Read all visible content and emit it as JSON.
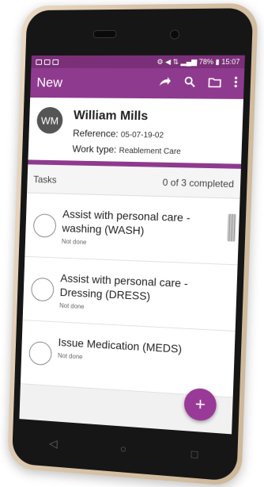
{
  "status_bar": {
    "right": "⚙ ◀ ⇅ ▂▄▆ 78% ▮ 15:07"
  },
  "app_bar": {
    "title": "New",
    "share_icon": "share-icon",
    "search_icon": "search-icon",
    "folder_icon": "folder-icon",
    "more_icon": "more-vert-icon"
  },
  "client": {
    "initials": "WM",
    "name": "William Mills",
    "reference_label": "Reference:",
    "reference_value": "05-07-19-02",
    "worktype_label": "Work type:",
    "worktype_value": "Reablement Care"
  },
  "tasks": {
    "label": "Tasks",
    "summary": "0 of 3 completed",
    "items": [
      {
        "name": "Assist with personal care - washing (WASH)",
        "status": "Not done"
      },
      {
        "name": "Assist with personal care - Dressing (DRESS)",
        "status": "Not done"
      },
      {
        "name": "Issue Medication (MEDS)",
        "status": "Not done"
      }
    ]
  },
  "fab": {
    "label": "+"
  },
  "nav": {
    "back": "◁",
    "home": "○",
    "recents": "□"
  },
  "colors": {
    "primary": "#8e3a8e",
    "status_bar": "#7a2f78",
    "fab": "#9a3a98"
  }
}
